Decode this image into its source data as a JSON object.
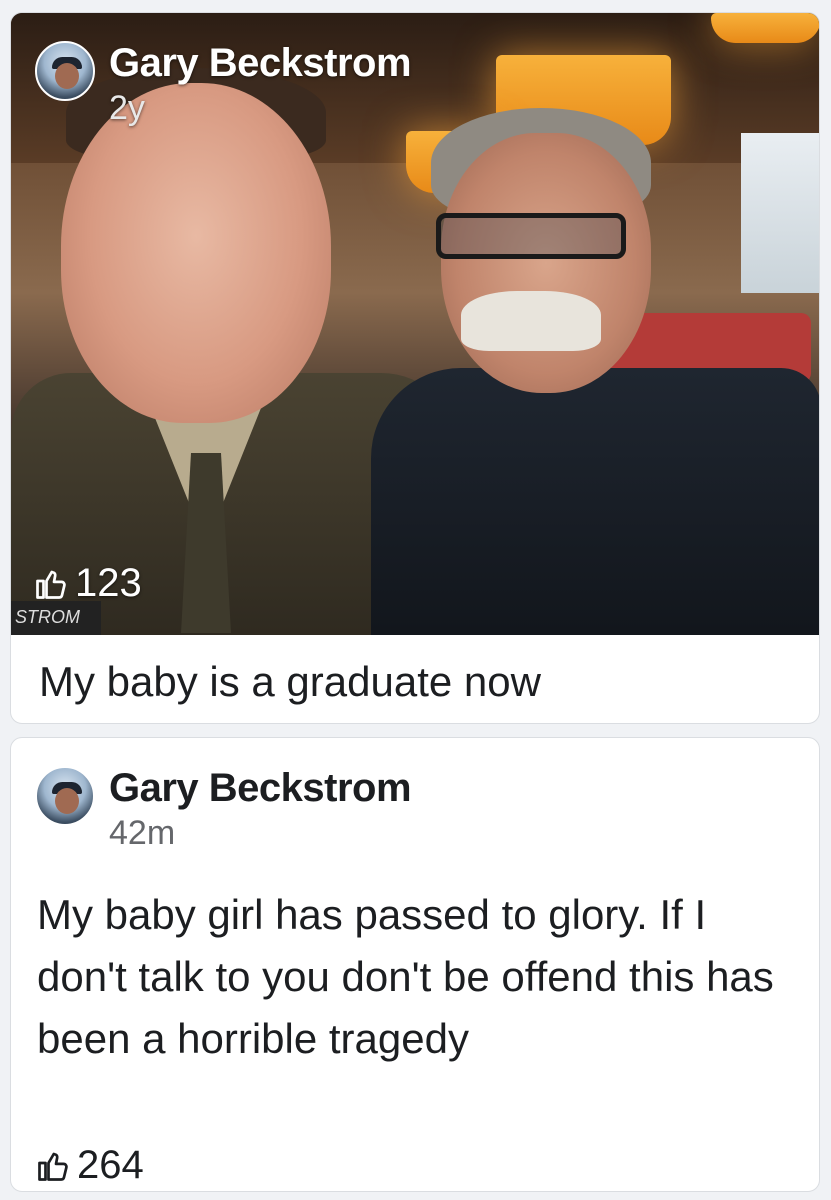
{
  "posts": [
    {
      "author": "Gary Beckstrom",
      "time": "2y",
      "likes": "123",
      "caption": "My baby is a graduate now",
      "photo_badge": "STROM"
    },
    {
      "author": "Gary Beckstrom",
      "time": "42m",
      "text": "My baby girl has passed to glory. If I don't talk to you don't be offend this has been a horrible tragedy",
      "likes": "264"
    }
  ],
  "icons": {
    "like": "thumbs-up-icon",
    "avatar": "profile-avatar"
  },
  "colors": {
    "text": "#1c1e21",
    "secondary": "#65676b",
    "card_border": "#dadde1"
  }
}
